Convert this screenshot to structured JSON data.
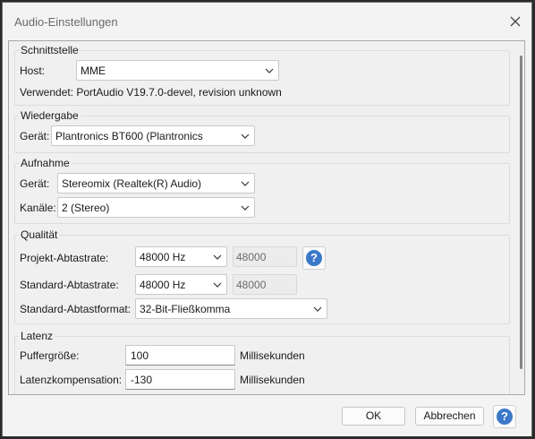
{
  "window": {
    "title": "Audio-Einstellungen"
  },
  "interface": {
    "section_title": "Schnittstelle",
    "host_label": "Host:",
    "host_value": "MME",
    "uses_text": "Verwendet: PortAudio V19.7.0-devel, revision unknown"
  },
  "playback": {
    "section_title": "Wiedergabe",
    "device_label": "Gerät:",
    "device_value": "Plantronics BT600 (Plantronics"
  },
  "recording": {
    "section_title": "Aufnahme",
    "device_label": "Gerät:",
    "device_value": "Stereomix (Realtek(R) Audio)",
    "channels_label": "Kanäle:",
    "channels_value": "2 (Stereo)"
  },
  "quality": {
    "section_title": "Qualität",
    "project_rate_label": "Projekt-Abtastrate:",
    "project_rate_value": "48000 Hz",
    "project_rate_field": "48000",
    "default_rate_label": "Standard-Abtastrate:",
    "default_rate_value": "48000 Hz",
    "default_rate_field": "48000",
    "sample_format_label": "Standard-Abtastformat:",
    "sample_format_value": "32-Bit-Fließkomma"
  },
  "latency": {
    "section_title": "Latenz",
    "buffer_label": "Puffergröße:",
    "buffer_value": "100",
    "buffer_unit": "Millisekunden",
    "compensation_label": "Latenzkompensation:",
    "compensation_value": "-130",
    "compensation_unit": "Millisekunden"
  },
  "footer": {
    "ok_label": "OK",
    "cancel_label": "Abbrechen"
  },
  "help_glyph": "?",
  "icons": {
    "close": "close-icon",
    "chevron": "chevron-down-icon",
    "help": "help-icon"
  },
  "colors": {
    "accent": "#3c78c8"
  }
}
